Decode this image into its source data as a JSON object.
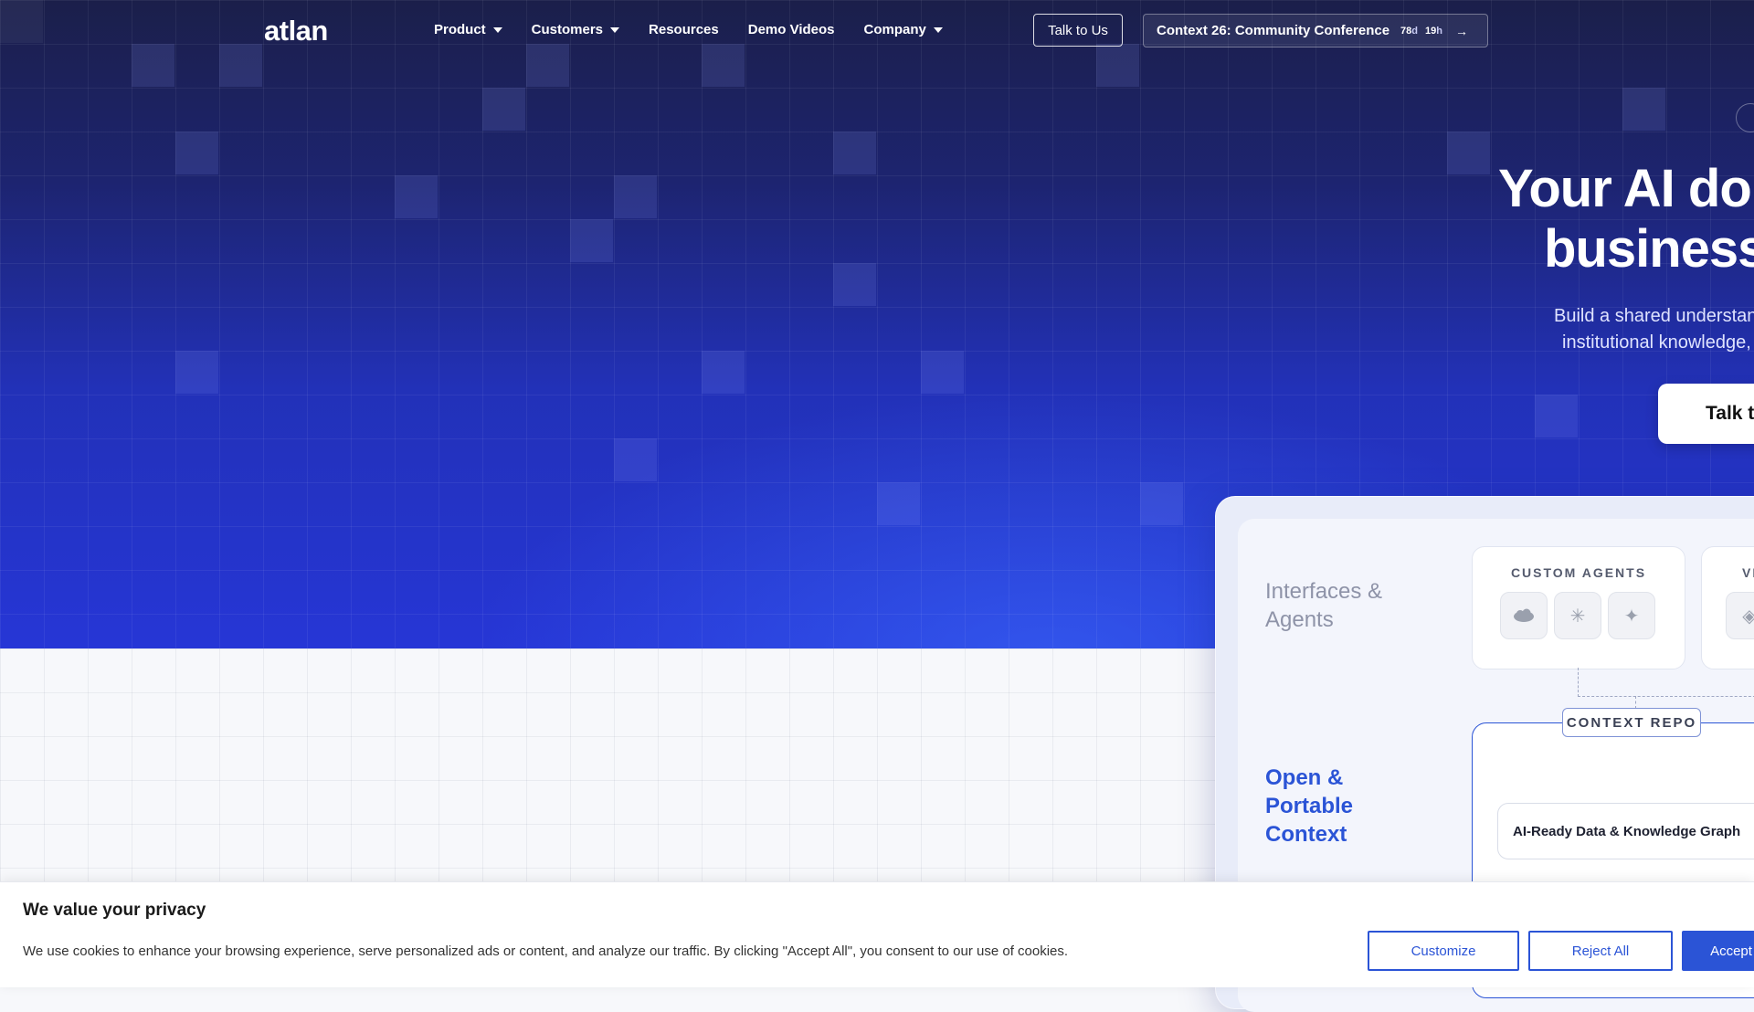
{
  "nav": {
    "logo": "atlan",
    "items": [
      {
        "label": "Product",
        "has_caret": true
      },
      {
        "label": "Customers",
        "has_caret": true
      },
      {
        "label": "Resources",
        "has_caret": false
      },
      {
        "label": "Demo Videos",
        "has_caret": false
      },
      {
        "label": "Company",
        "has_caret": true
      }
    ],
    "talk_button": "Talk to Us",
    "conference": {
      "label": "Context 26: Community Conference",
      "days": "78",
      "days_unit": "d",
      "hours": "19",
      "hours_unit": "h",
      "arrow": "→"
    }
  },
  "hero": {
    "headline_line1": "Your AI do",
    "headline_line2": "business",
    "subtext_line1": "Build a shared understandi",
    "subtext_line2": "institutional knowledge, a",
    "cta": "Talk t"
  },
  "card": {
    "interfaces_label": "Interfaces & Agents",
    "context_label": "Open & Portable Context",
    "custom_agents": {
      "title": "CUSTOM AGENTS",
      "icons": [
        "salesforce-icon",
        "snowflake-icon",
        "sparkle-icon"
      ]
    },
    "second_box_title": "VI",
    "context_repo": "CONTEXT REPO",
    "knowledge_graph": "AI-Ready Data & Knowledge Graph"
  },
  "cookie": {
    "title": "We value your privacy",
    "text": "We use cookies to enhance your browsing experience, serve personalized ads or content, and analyze our traffic. By clicking \"Accept All\", you consent to our use of cookies.",
    "customize": "Customize",
    "reject": "Reject All",
    "accept": "Accept All"
  },
  "colors": {
    "brand_blue": "#2b54d6",
    "hero_dark": "#1b1f4a",
    "hero_bright": "#2636d6"
  }
}
